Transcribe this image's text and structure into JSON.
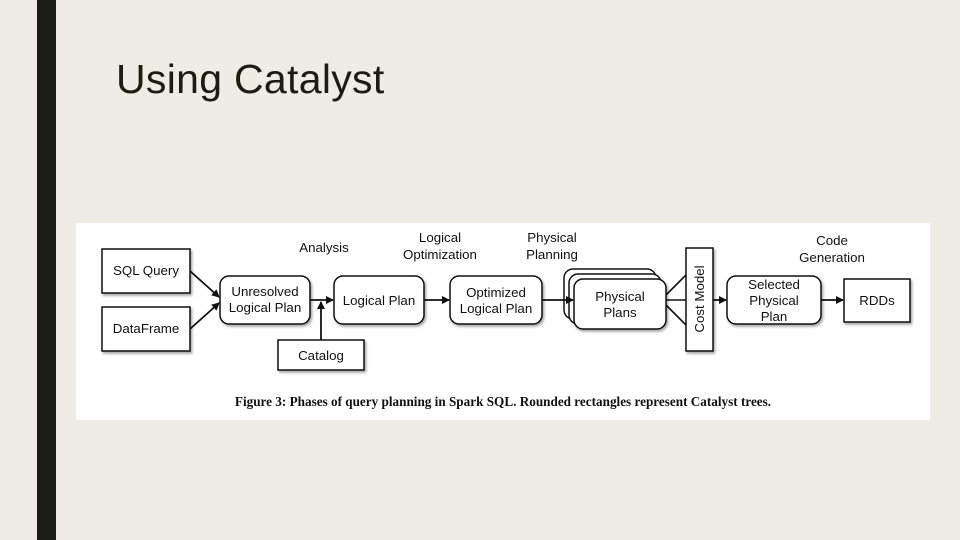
{
  "slide": {
    "title": "Using Catalyst"
  },
  "diagram": {
    "phase_labels": {
      "analysis": "Analysis",
      "logical_optimization": [
        "Logical",
        "Optimization"
      ],
      "physical_planning": [
        "Physical",
        "Planning"
      ],
      "code_generation": [
        "Code",
        "Generation"
      ]
    },
    "nodes": {
      "sql_query": "SQL Query",
      "dataframe": "DataFrame",
      "unresolved_logical_plan": [
        "Unresolved",
        "Logical Plan"
      ],
      "catalog": "Catalog",
      "logical_plan": "Logical Plan",
      "optimized_logical_plan": [
        "Optimized",
        "Logical Plan"
      ],
      "physical_plans": [
        "Physical",
        "Plans"
      ],
      "cost_model": "Cost Model",
      "selected_physical_plan": [
        "Selected",
        "Physical",
        "Plan"
      ],
      "rdds": "RDDs"
    },
    "edges": [
      {
        "from": "SQL Query",
        "to": "Unresolved Logical Plan"
      },
      {
        "from": "DataFrame",
        "to": "Unresolved Logical Plan"
      },
      {
        "from": "Unresolved Logical Plan",
        "to": "Logical Plan"
      },
      {
        "from": "Catalog",
        "to": "Logical Plan"
      },
      {
        "from": "Logical Plan",
        "to": "Optimized Logical Plan"
      },
      {
        "from": "Optimized Logical Plan",
        "to": "Physical Plans"
      },
      {
        "from": "Physical Plans",
        "to": "Cost Model"
      },
      {
        "from": "Cost Model",
        "to": "Selected Physical Plan"
      },
      {
        "from": "Selected Physical Plan",
        "to": "RDDs"
      }
    ],
    "caption": "Figure 3: Phases of query planning in Spark SQL. Rounded rectangles represent Catalyst trees."
  }
}
